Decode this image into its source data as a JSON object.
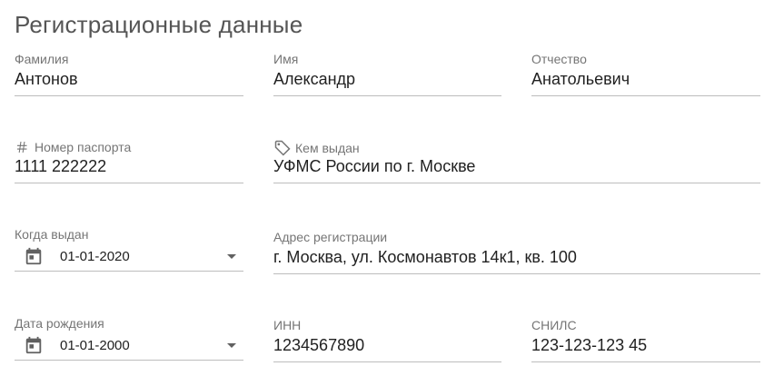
{
  "title": "Регистрационные данные",
  "fields": {
    "surname": {
      "label": "Фамилия",
      "value": "Антонов"
    },
    "name": {
      "label": "Имя",
      "value": "Александр"
    },
    "patronymic": {
      "label": "Отчество",
      "value": "Анатольевич"
    },
    "passport": {
      "label": "Номер паспорта",
      "value": "1111 222222",
      "icon": "hash-icon"
    },
    "issued_by": {
      "label": "Кем выдан",
      "value": "УФМС России по г. Москве",
      "icon": "tag-icon"
    },
    "issue_date": {
      "label": "Когда выдан",
      "value": "01-01-2020",
      "icon": "calendar-icon"
    },
    "address": {
      "label": "Адрес регистрации",
      "value": "г. Москва, ул. Космонавтов 14к1, кв. 100"
    },
    "birth_date": {
      "label": "Дата рождения",
      "value": "01-01-2000",
      "icon": "calendar-icon"
    },
    "inn": {
      "label": "ИНН",
      "value": "1234567890"
    },
    "snils": {
      "label": "СНИЛС",
      "value": "123-123-123 45"
    }
  },
  "colors": {
    "label": "#757575",
    "underline": "#bdbdbd",
    "text": "#212121"
  }
}
